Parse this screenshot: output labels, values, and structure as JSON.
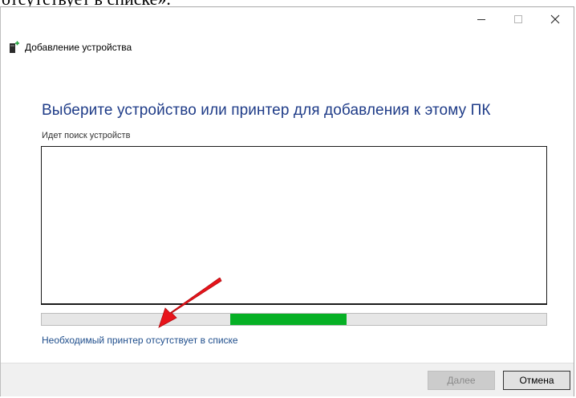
{
  "article": {
    "caption_fragment": "отсутствует в списке»."
  },
  "window": {
    "title": "Добавление устройства",
    "icon": "printer-add-icon",
    "controls": {
      "minimize": "minimize-icon",
      "maximize": "maximize-icon",
      "close": "close-icon"
    }
  },
  "main": {
    "heading": "Выберите устройство или принтер для добавления к этому ПК",
    "status": "Идет поиск устройств",
    "progress": {
      "fill_start": 0.373,
      "fill_end": 0.604,
      "color": "#06b025"
    },
    "missing_printer_link": "Необходимый принтер отсутствует в списке"
  },
  "annotation": {
    "arrow_color": "#e8141b"
  },
  "footer": {
    "next_label": "Далее",
    "cancel_label": "Отмена"
  }
}
